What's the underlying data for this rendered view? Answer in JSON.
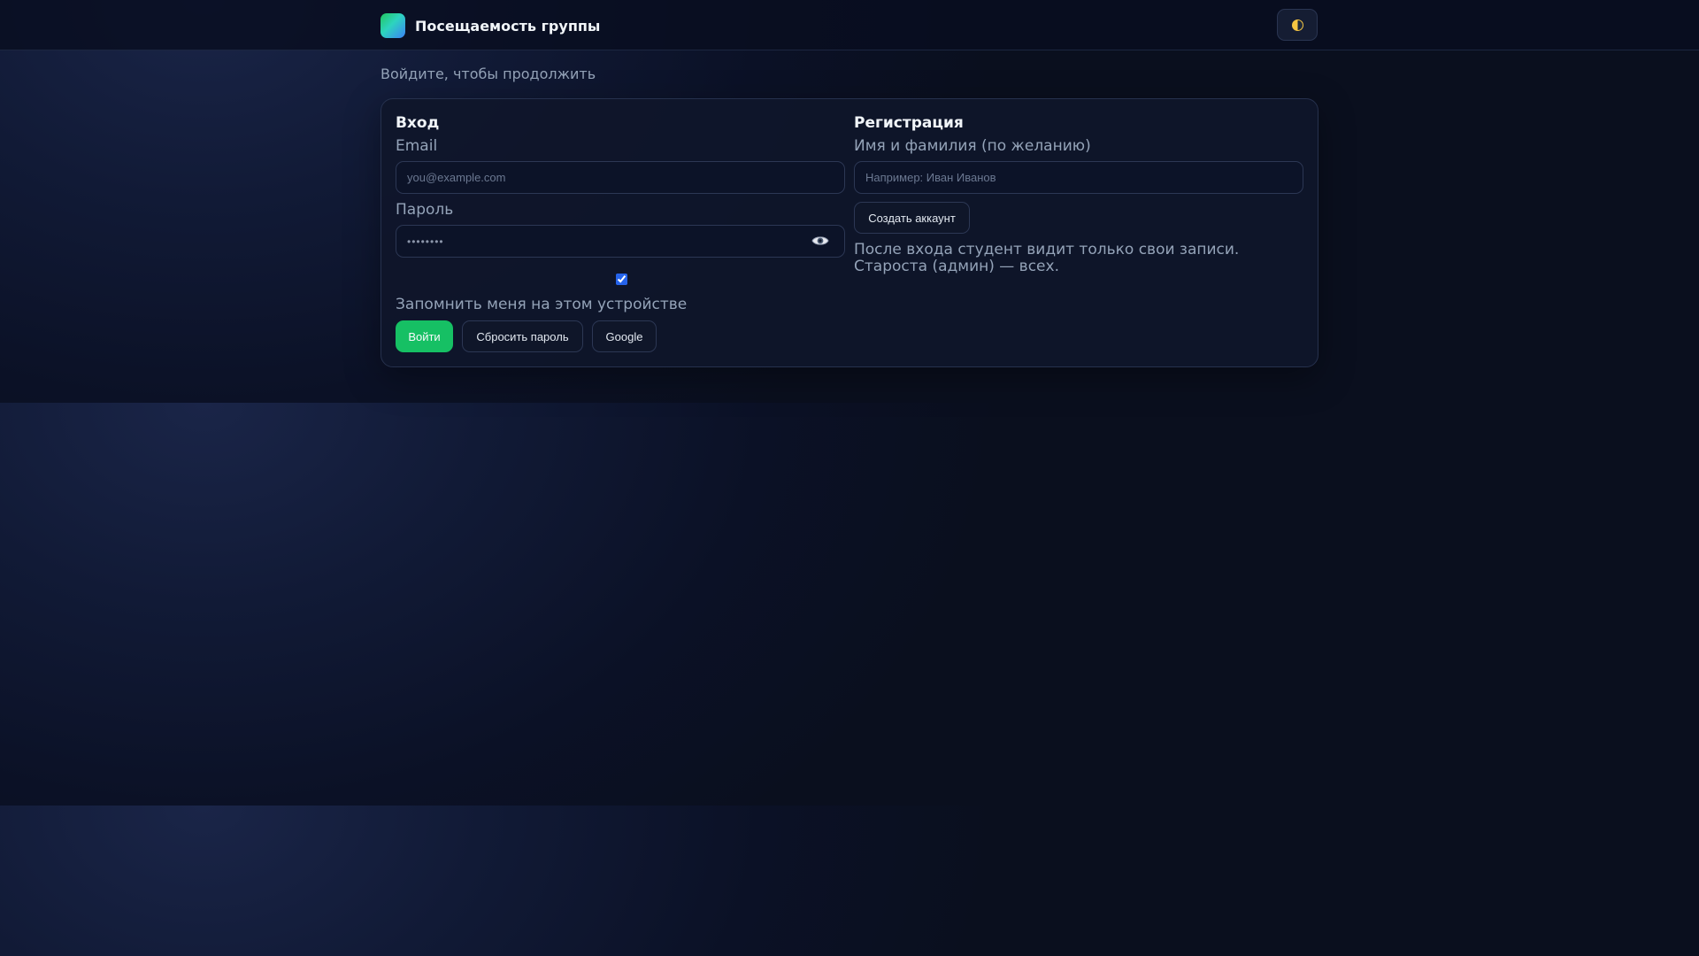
{
  "header": {
    "title": "Посещаемость группы",
    "theme_toggle_icon": "half-moon-icon"
  },
  "subtitle": "Войдите, чтобы продолжить",
  "login": {
    "title": "Вход",
    "email_label": "Email",
    "email_placeholder": "you@example.com",
    "password_label": "Пароль",
    "password_placeholder": "••••••••",
    "show_password_icon": "eye-icon",
    "remember_checked": true,
    "remember_label": "Запомнить меня на этом устройстве",
    "submit_label": "Войти",
    "reset_label": "Сбросить пароль",
    "google_label": "Google"
  },
  "register": {
    "title": "Регистрация",
    "name_label": "Имя и фамилия (по желанию)",
    "name_placeholder": "Например: Иван Иванов",
    "create_label": "Создать аккаунт",
    "note": "После входа студент видит только свои записи. Староста (админ) — всех."
  },
  "colors": {
    "accent_green": "#16c064",
    "background": "#0a0f1e",
    "card": "#0f162a",
    "checkbox": "#2563eb"
  }
}
